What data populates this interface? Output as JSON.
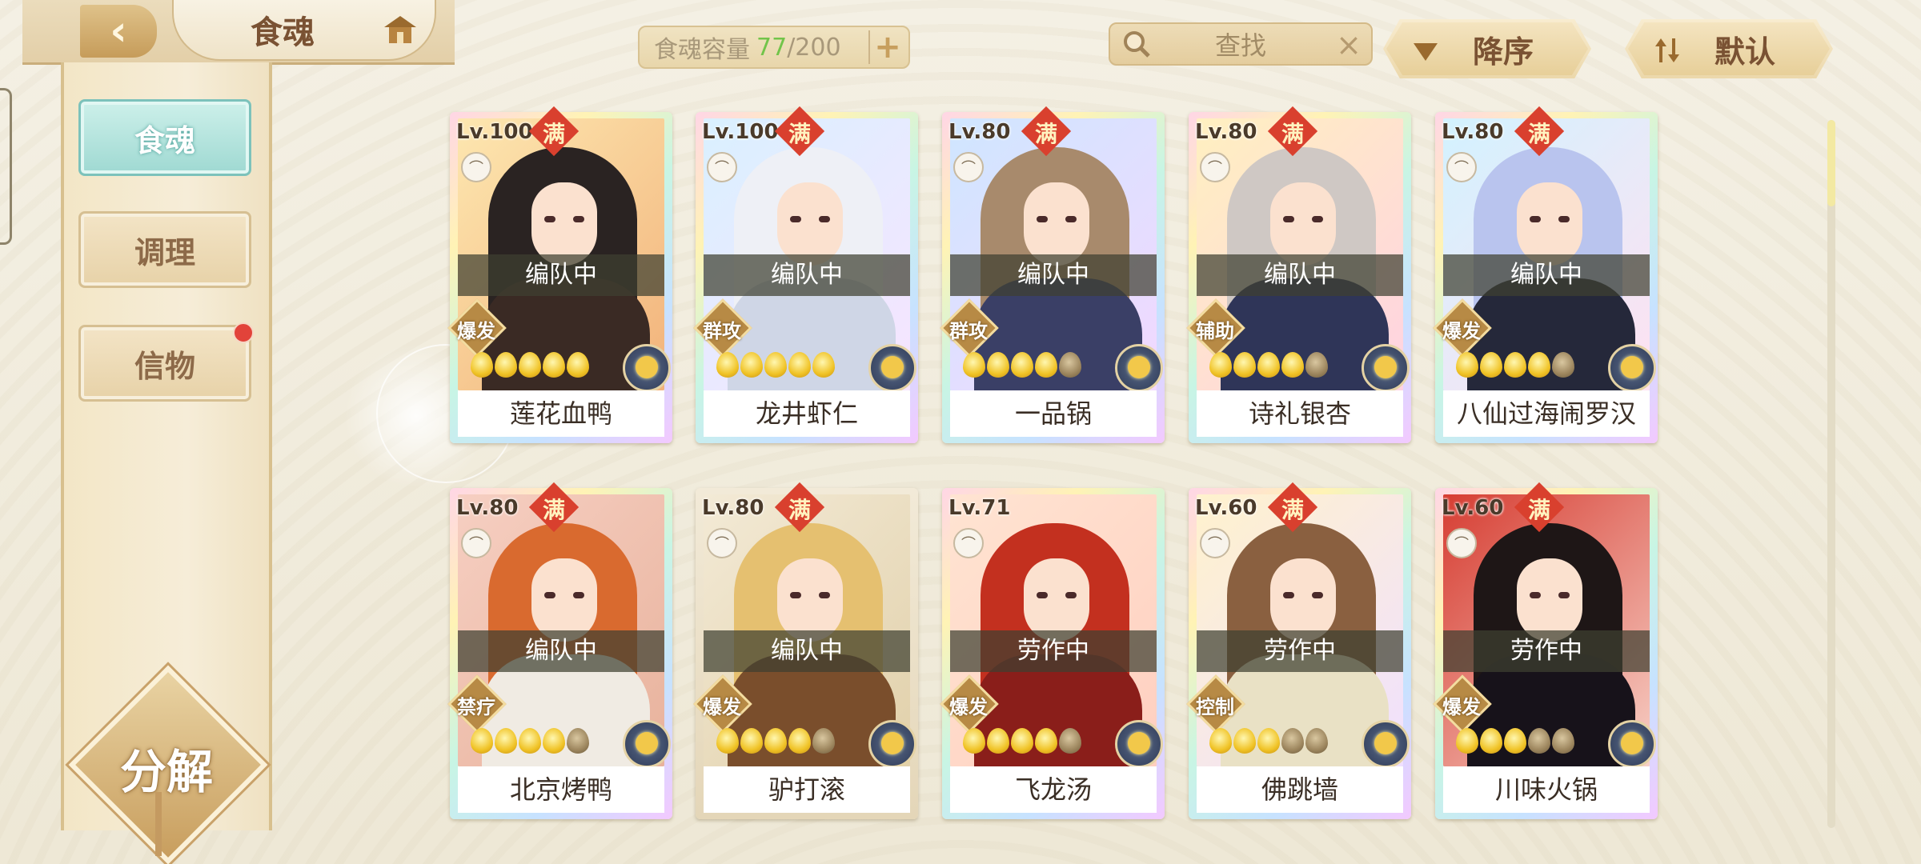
{
  "header": {
    "title": "食魂",
    "capacity": {
      "label": "食魂容量",
      "current": "77",
      "separator": "/",
      "max": "200"
    },
    "search_placeholder": "查找",
    "sort_label": "降序",
    "filter_label": "默认"
  },
  "sidebar": {
    "items": [
      {
        "label": "食魂",
        "active": true
      },
      {
        "label": "调理",
        "active": false
      },
      {
        "label": "信物",
        "active": false,
        "badge": true
      }
    ],
    "decompose_label": "分解"
  },
  "cards": [
    {
      "level": "Lv.100",
      "full": "满",
      "status": "编队中",
      "role": "爆发",
      "stars_on": 5,
      "name": "莲花血鸭"
    },
    {
      "level": "Lv.100",
      "full": "满",
      "status": "编队中",
      "role": "群攻",
      "stars_on": 5,
      "name": "龙井虾仁"
    },
    {
      "level": "Lv.80",
      "full": "满",
      "status": "编队中",
      "role": "群攻",
      "stars_on": 4,
      "name": "一品锅"
    },
    {
      "level": "Lv.80",
      "full": "满",
      "status": "编队中",
      "role": "辅助",
      "stars_on": 4,
      "name": "诗礼银杏"
    },
    {
      "level": "Lv.80",
      "full": "满",
      "status": "编队中",
      "role": "爆发",
      "stars_on": 4,
      "name": "八仙过海闹罗汉"
    },
    {
      "level": "Lv.80",
      "full": "满",
      "status": "编队中",
      "role": "禁疗",
      "stars_on": 4,
      "name": "北京烤鸭"
    },
    {
      "level": "Lv.80",
      "full": "满",
      "status": "编队中",
      "role": "爆发",
      "stars_on": 4,
      "name": "驴打滚"
    },
    {
      "level": "Lv.71",
      "full": "",
      "status": "劳作中",
      "role": "爆发",
      "stars_on": 4,
      "name": "飞龙汤"
    },
    {
      "level": "Lv.60",
      "full": "满",
      "status": "劳作中",
      "role": "控制",
      "stars_on": 3,
      "name": "佛跳墙"
    },
    {
      "level": "Lv.60",
      "full": "满",
      "status": "劳作中",
      "role": "爆发",
      "stars_on": 3,
      "name": "川味火锅"
    }
  ]
}
